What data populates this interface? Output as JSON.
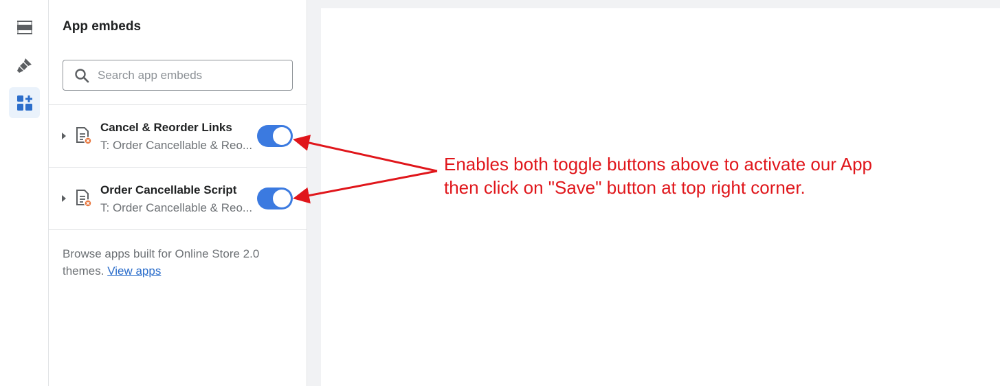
{
  "rail": {
    "items": [
      {
        "icon": "sections-icon",
        "active": false
      },
      {
        "icon": "theme-settings-brush-icon",
        "active": false
      },
      {
        "icon": "app-embeds-icon",
        "active": true
      }
    ]
  },
  "panel": {
    "title": "App embeds",
    "search": {
      "placeholder": "Search app embeds",
      "value": ""
    },
    "embeds": [
      {
        "name": "Cancel & Reorder Links",
        "subtitle": "T: Order Cancellable & Reo...",
        "enabled": true
      },
      {
        "name": "Order Cancellable Script",
        "subtitle": "T: Order Cancellable & Reo...",
        "enabled": true
      }
    ],
    "browse": {
      "text": "Browse apps built for Online Store 2.0 themes.",
      "link": "View apps"
    }
  },
  "annotation": {
    "line1": "Enables both toggle buttons above to activate our App",
    "line2": "then click on \"Save\" button at top right corner.",
    "color": "#e0161b"
  },
  "colors": {
    "accent": "#3b7ae0",
    "link": "#2c6ecb"
  }
}
